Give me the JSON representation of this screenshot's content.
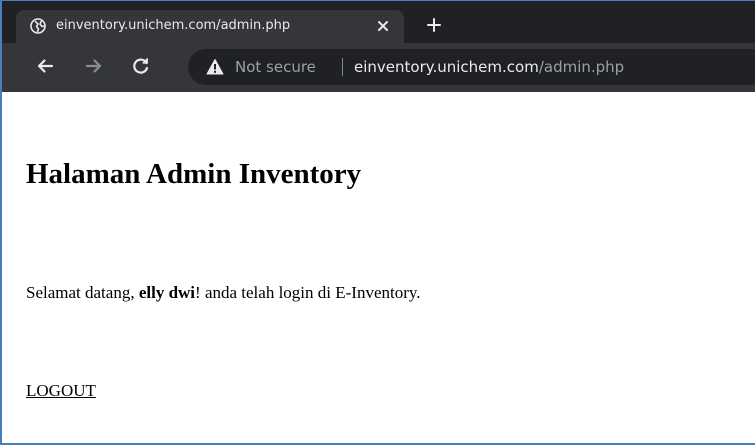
{
  "browser": {
    "tab": {
      "title": "einventory.unichem.com/admin.php",
      "favicon": "globe-icon"
    },
    "security_label": "Not secure",
    "url": {
      "host": "einventory.unichem.com",
      "path": "/admin.php"
    },
    "icons": {
      "close": "close-icon",
      "new_tab": "plus-icon",
      "back": "back-arrow-icon",
      "forward": "forward-arrow-icon",
      "reload": "reload-icon",
      "security": "warning-icon"
    },
    "colors": {
      "tabstrip": "#202124",
      "toolbar": "#35363a",
      "omnibox": "#202124",
      "text": "#e8eaed",
      "muted": "#9aa0a6"
    }
  },
  "page": {
    "heading": "Halaman Admin Inventory",
    "welcome_prefix": "Selamat datang, ",
    "username": "elly dwi",
    "welcome_suffix": "! anda telah login di E-Inventory.",
    "logout_label": "LOGOUT"
  }
}
